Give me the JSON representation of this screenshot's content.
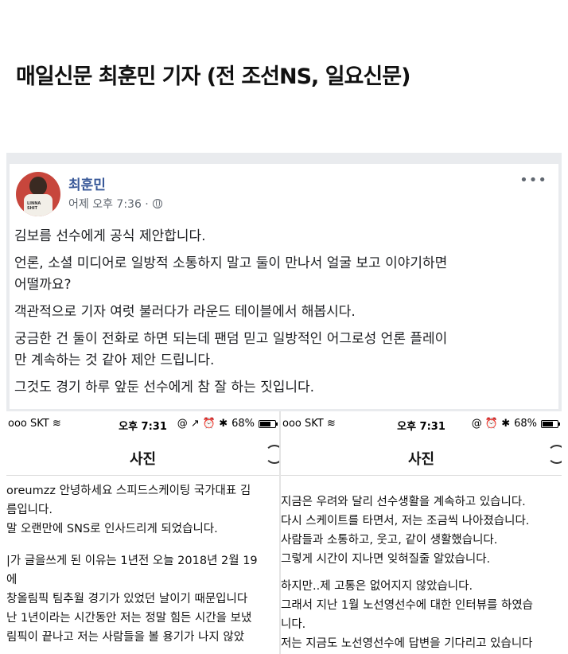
{
  "headline": "매일신문 최훈민 기자 (전 조선NS, 일요신문)",
  "post": {
    "author": "최훈민",
    "timestamp": "어제 오후 7:36 · ",
    "avatar_text": "LINNA SHIT",
    "lines": [
      "김보름 선수에게 공식 제안합니다.",
      "언론, 소셜 미디어로 일방적 소통하지 말고 둘이 만나서 얼굴 보고 이야기하면",
      "어떨까요?",
      "객관적으로 기자 여럿 불러다가 라운드 테이블에서 해봅시다.",
      "궁금한 건 둘이 전화로 하면 되는데 팬덤 믿고 일방적인 어그로성 언론 플레이",
      "만 계속하는 것 같아 제안 드립니다.",
      "그것도 경기 하루 앞둔 선수에게 참 잘 하는 짓입니다."
    ],
    "more_icon": "more-dots-icon"
  },
  "phone_left": {
    "carrier": "ooo SKT ",
    "time": "오후 7:31",
    "status_icons": "@ ↗ ⏰ ✱",
    "battery": "68%",
    "title": "사진",
    "lines": [
      "oreumzz 안녕하세요 스피드스케이팅 국가대표 김",
      "름입니다.",
      "말 오랜만에 SNS로 인사드리게 되었습니다.",
      "",
      "|가 글을쓰게 된 이유는 1년전 오늘 2018년 2월 19",
      "에",
      "창올림픽 팀추월 경기가 있었던 날이기 때문입니다",
      "난 1년이라는 시간동안 저는 정말 힘든 시간을 보냈",
      "림픽이 끝나고 저는 사람들을 볼 용기가 나지 않았"
    ]
  },
  "phone_right": {
    "carrier": "ooo SKT ",
    "time": "오후 7:31",
    "status_icons": "@ ⏰ ✱",
    "battery": "68%",
    "title": "사진",
    "lines": [
      "지금은 우려와 달리 선수생활을 계속하고 있습니다.",
      "다시 스케이트를 타면서, 저는 조금씩 나아졌습니다.",
      "사람들과 소통하고, 웃고, 같이 생활했습니다.",
      "그렇게 시간이 지나면 잊혀질줄 알았습니다.",
      "",
      "하지만..제 고통은 없어지지 않았습니다.",
      "그래서 지난 1월 노선영선수에 대한 인터뷰를 하였습",
      "니다.",
      "저는 지금도 노선영선수에 답변을 기다리고 있습니다"
    ]
  }
}
